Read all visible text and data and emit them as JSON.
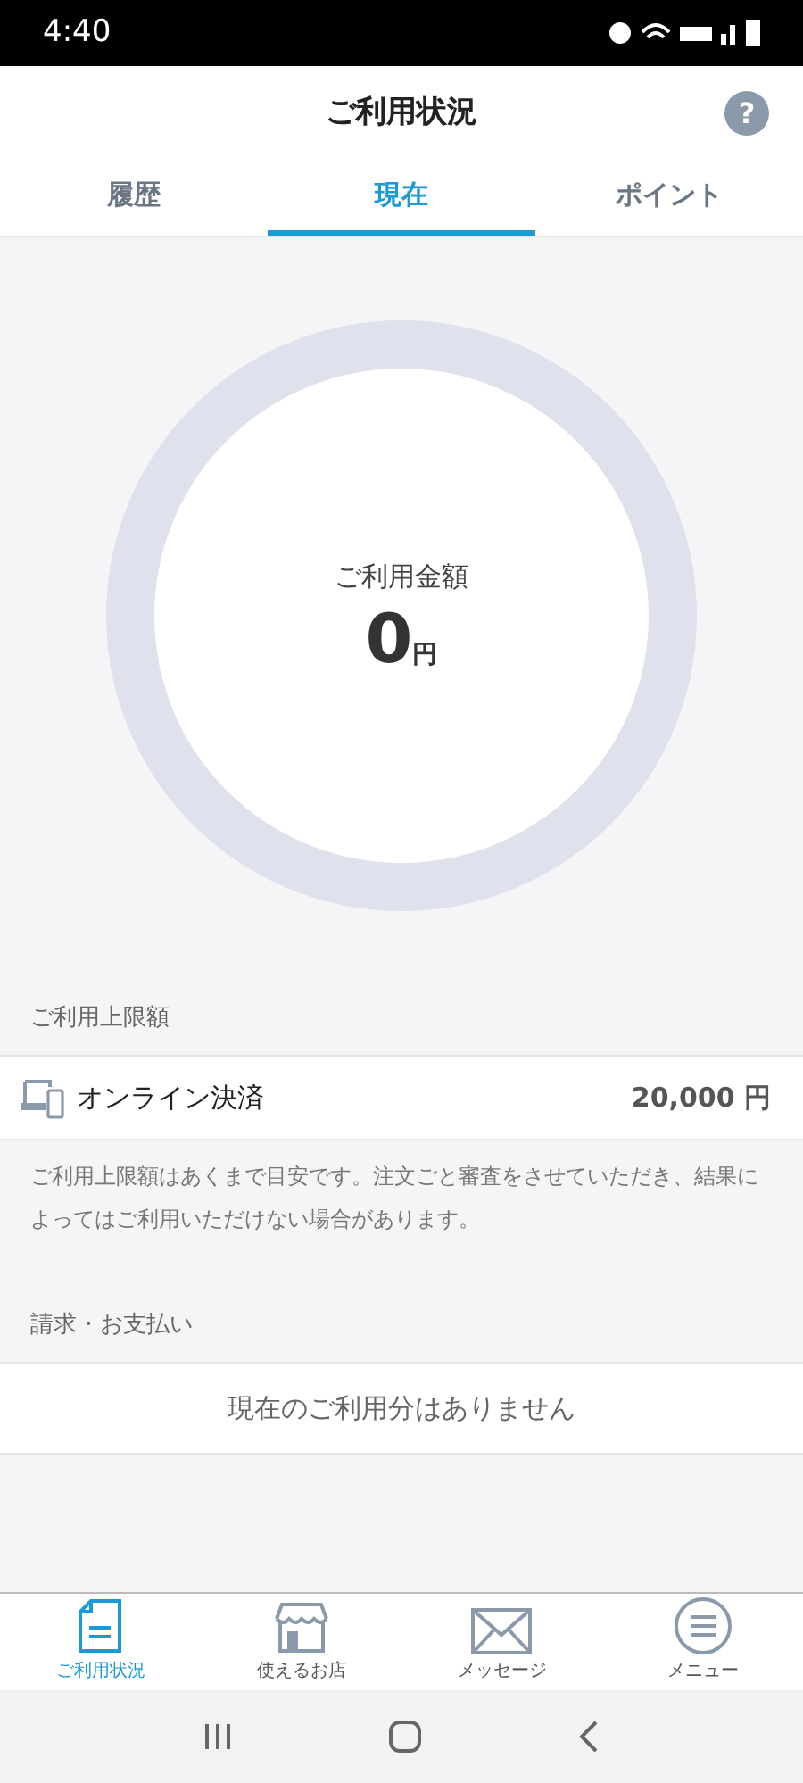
{
  "status_bar": {
    "time": "4:40"
  },
  "header": {
    "title": "ご利用状況",
    "help": "?"
  },
  "tabs": [
    {
      "label": "履歴",
      "selected": false
    },
    {
      "label": "現在",
      "selected": true
    },
    {
      "label": "ポイント",
      "selected": false
    }
  ],
  "usage": {
    "label": "ご利用金額",
    "amount": "0",
    "unit": "円",
    "level": 0
  },
  "limit_section": {
    "heading": "ご利用上限額",
    "item": {
      "name": "オンライン決済",
      "value": "20,000 円"
    },
    "note": "ご利用上限額はあくまで目安です。注文ごと審査をさせていただき、結果によってはご利用いただけない場合があります。"
  },
  "billing_section": {
    "heading": "請求・お支払い",
    "message": "現在のご利用分はありません"
  },
  "bottom_nav": [
    {
      "kind": "document",
      "label": "ご利用状況",
      "selected": true
    },
    {
      "kind": "store",
      "label": "使えるお店",
      "selected": false
    },
    {
      "kind": "mail",
      "label": "メッセージ",
      "selected": false
    },
    {
      "kind": "menu",
      "label": "メニュー",
      "selected": false
    }
  ]
}
